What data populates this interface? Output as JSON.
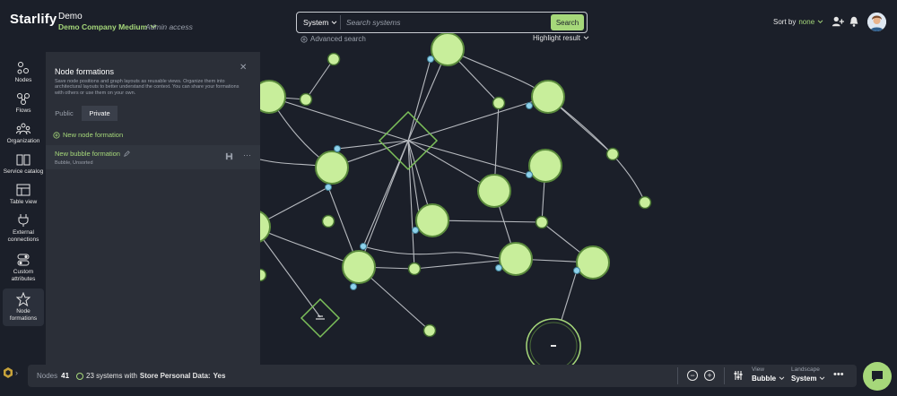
{
  "header": {
    "logo": "Starlify",
    "workspace": "Demo",
    "company": "Demo Company Medium",
    "access": "Admin access"
  },
  "search": {
    "scope": "System",
    "placeholder": "Search systems",
    "button": "Search",
    "advanced": "Advanced search",
    "highlight": "Highlight result"
  },
  "toolbar": {
    "sort_label": "Sort by",
    "sort_value": "none"
  },
  "sidebar": {
    "items": [
      {
        "label": "Nodes",
        "icon": "nodes-icon"
      },
      {
        "label": "Flows",
        "icon": "flows-icon"
      },
      {
        "label": "Organization",
        "icon": "organization-icon"
      },
      {
        "label": "Service catalog",
        "icon": "service-catalog-icon"
      },
      {
        "label": "Table view",
        "icon": "table-view-icon"
      },
      {
        "label": "External connections",
        "icon": "plug-icon"
      },
      {
        "label": "Custom attributes",
        "icon": "toggles-icon"
      },
      {
        "label": "Node formations",
        "icon": "star-icon"
      }
    ]
  },
  "panel": {
    "title": "Node formations",
    "description": "Save node positions and graph layouts as reusable views. Organize them into architectural layouts to better understand the context. You can share your formations with others or use them on your own.",
    "tabs": [
      "Public",
      "Private"
    ],
    "active_tab": "Private",
    "new_label": "New node formation",
    "formations": [
      {
        "name": "New bubble formation",
        "meta": "Bubble, Unsorted"
      }
    ]
  },
  "bottom": {
    "nodes_label": "Nodes",
    "nodes_count": "41",
    "filter_prefix": "23 systems with",
    "filter_key": "Store Personal Data:",
    "filter_value": "Yes",
    "view_label": "View",
    "view_value": "Bubble",
    "landscape_label": "Landscape",
    "landscape_value": "System"
  },
  "colors": {
    "background": "#1b1f29",
    "accent": "#a6d87a",
    "panel": "#2b2f38"
  }
}
